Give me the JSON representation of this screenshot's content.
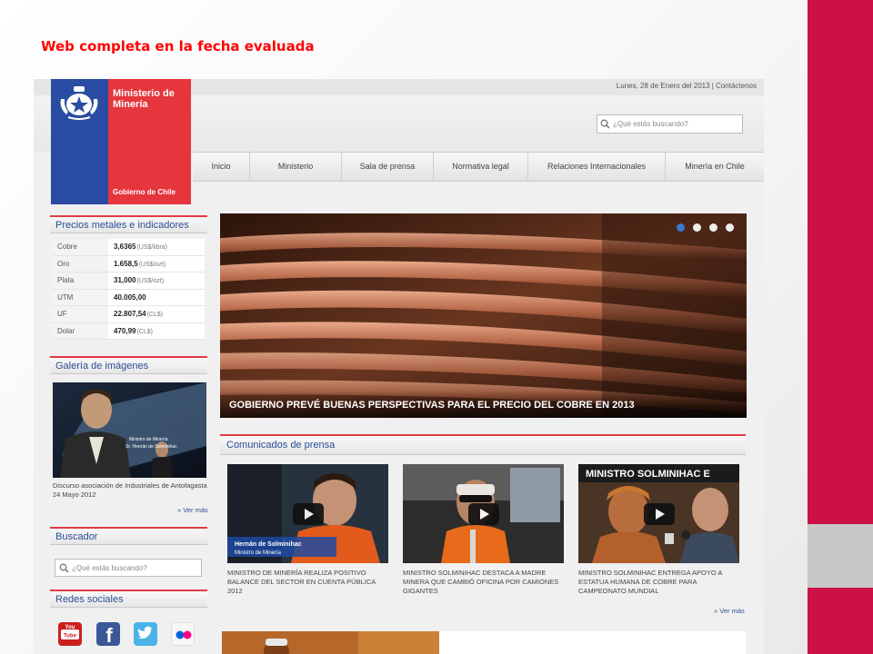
{
  "slide_title": "Web completa en la fecha evaluada",
  "topbar": {
    "date": "Lunes, 28 de Enero del 2013",
    "separator": " | ",
    "contact": "Contáctenos"
  },
  "logo": {
    "line1": "Ministerio de",
    "line2": "Minería",
    "gov": "Gobierno de Chile"
  },
  "search": {
    "placeholder": "¿Qué estás buscando?"
  },
  "nav": [
    "Inicio",
    "Ministerio",
    "Sala de prensa",
    "Normativa legal",
    "Relaciones Internacionales",
    "Minería en Chile"
  ],
  "prices": {
    "title": "Precios metales e indicadores",
    "rows": [
      {
        "name": "Cobre",
        "value": "3,6365",
        "unit": "(US$/libra)"
      },
      {
        "name": "Oro",
        "value": "1.658,5",
        "unit": "(US$/ozt)"
      },
      {
        "name": "Plata",
        "value": "31,000",
        "unit": "(US$/ozt)"
      },
      {
        "name": "UTM",
        "value": "40.005,00",
        "unit": ""
      },
      {
        "name": "UF",
        "value": "22.807,54",
        "unit": "(CL$)"
      },
      {
        "name": "Dolar",
        "value": "470,99",
        "unit": "(CL$)"
      }
    ]
  },
  "gallery": {
    "title": "Galería de imágenes",
    "caption": "Discurso asociación de Industriales de Antofagasta 24 Mayo 2012",
    "image_text": "Ministro de Minería Sr. Hernán de Solminihac",
    "more": "» Ver más"
  },
  "buscador": {
    "title": "Buscador",
    "placeholder": "¿Qué estás buscando?"
  },
  "redes": {
    "title": "Redes sociales",
    "items": [
      "youtube-icon",
      "facebook-icon",
      "twitter-icon",
      "flickr-icon"
    ]
  },
  "hero": {
    "caption": "GOBIERNO PREVÉ BUENAS PERSPECTIVAS PARA EL PRECIO DEL COBRE EN 2013",
    "slides": 4,
    "active_slide": 1
  },
  "comunicados": {
    "title": "Comunicados de prensa",
    "items": [
      {
        "caption": "Ministro de Minería realiza positivo balance del sector en Cuenta Pública 2012",
        "overlay_name": "Hernán de Solminihac",
        "overlay_role": "Ministro de Minería"
      },
      {
        "caption": "Ministro Solminihac destaca a madre minera que cambió oficina por camiones gigantes"
      },
      {
        "caption": "Ministro Solminihac entrega apoyo a estatua humana de cobre para campeonato mundial",
        "overlay_title": "MINISTRO SOLMINIHAC E"
      }
    ],
    "more": "» Ver más"
  },
  "colors": {
    "red": "#e5363d",
    "blue": "#2b4ca3",
    "accent": "#cc1146",
    "link": "#2a4e96"
  }
}
